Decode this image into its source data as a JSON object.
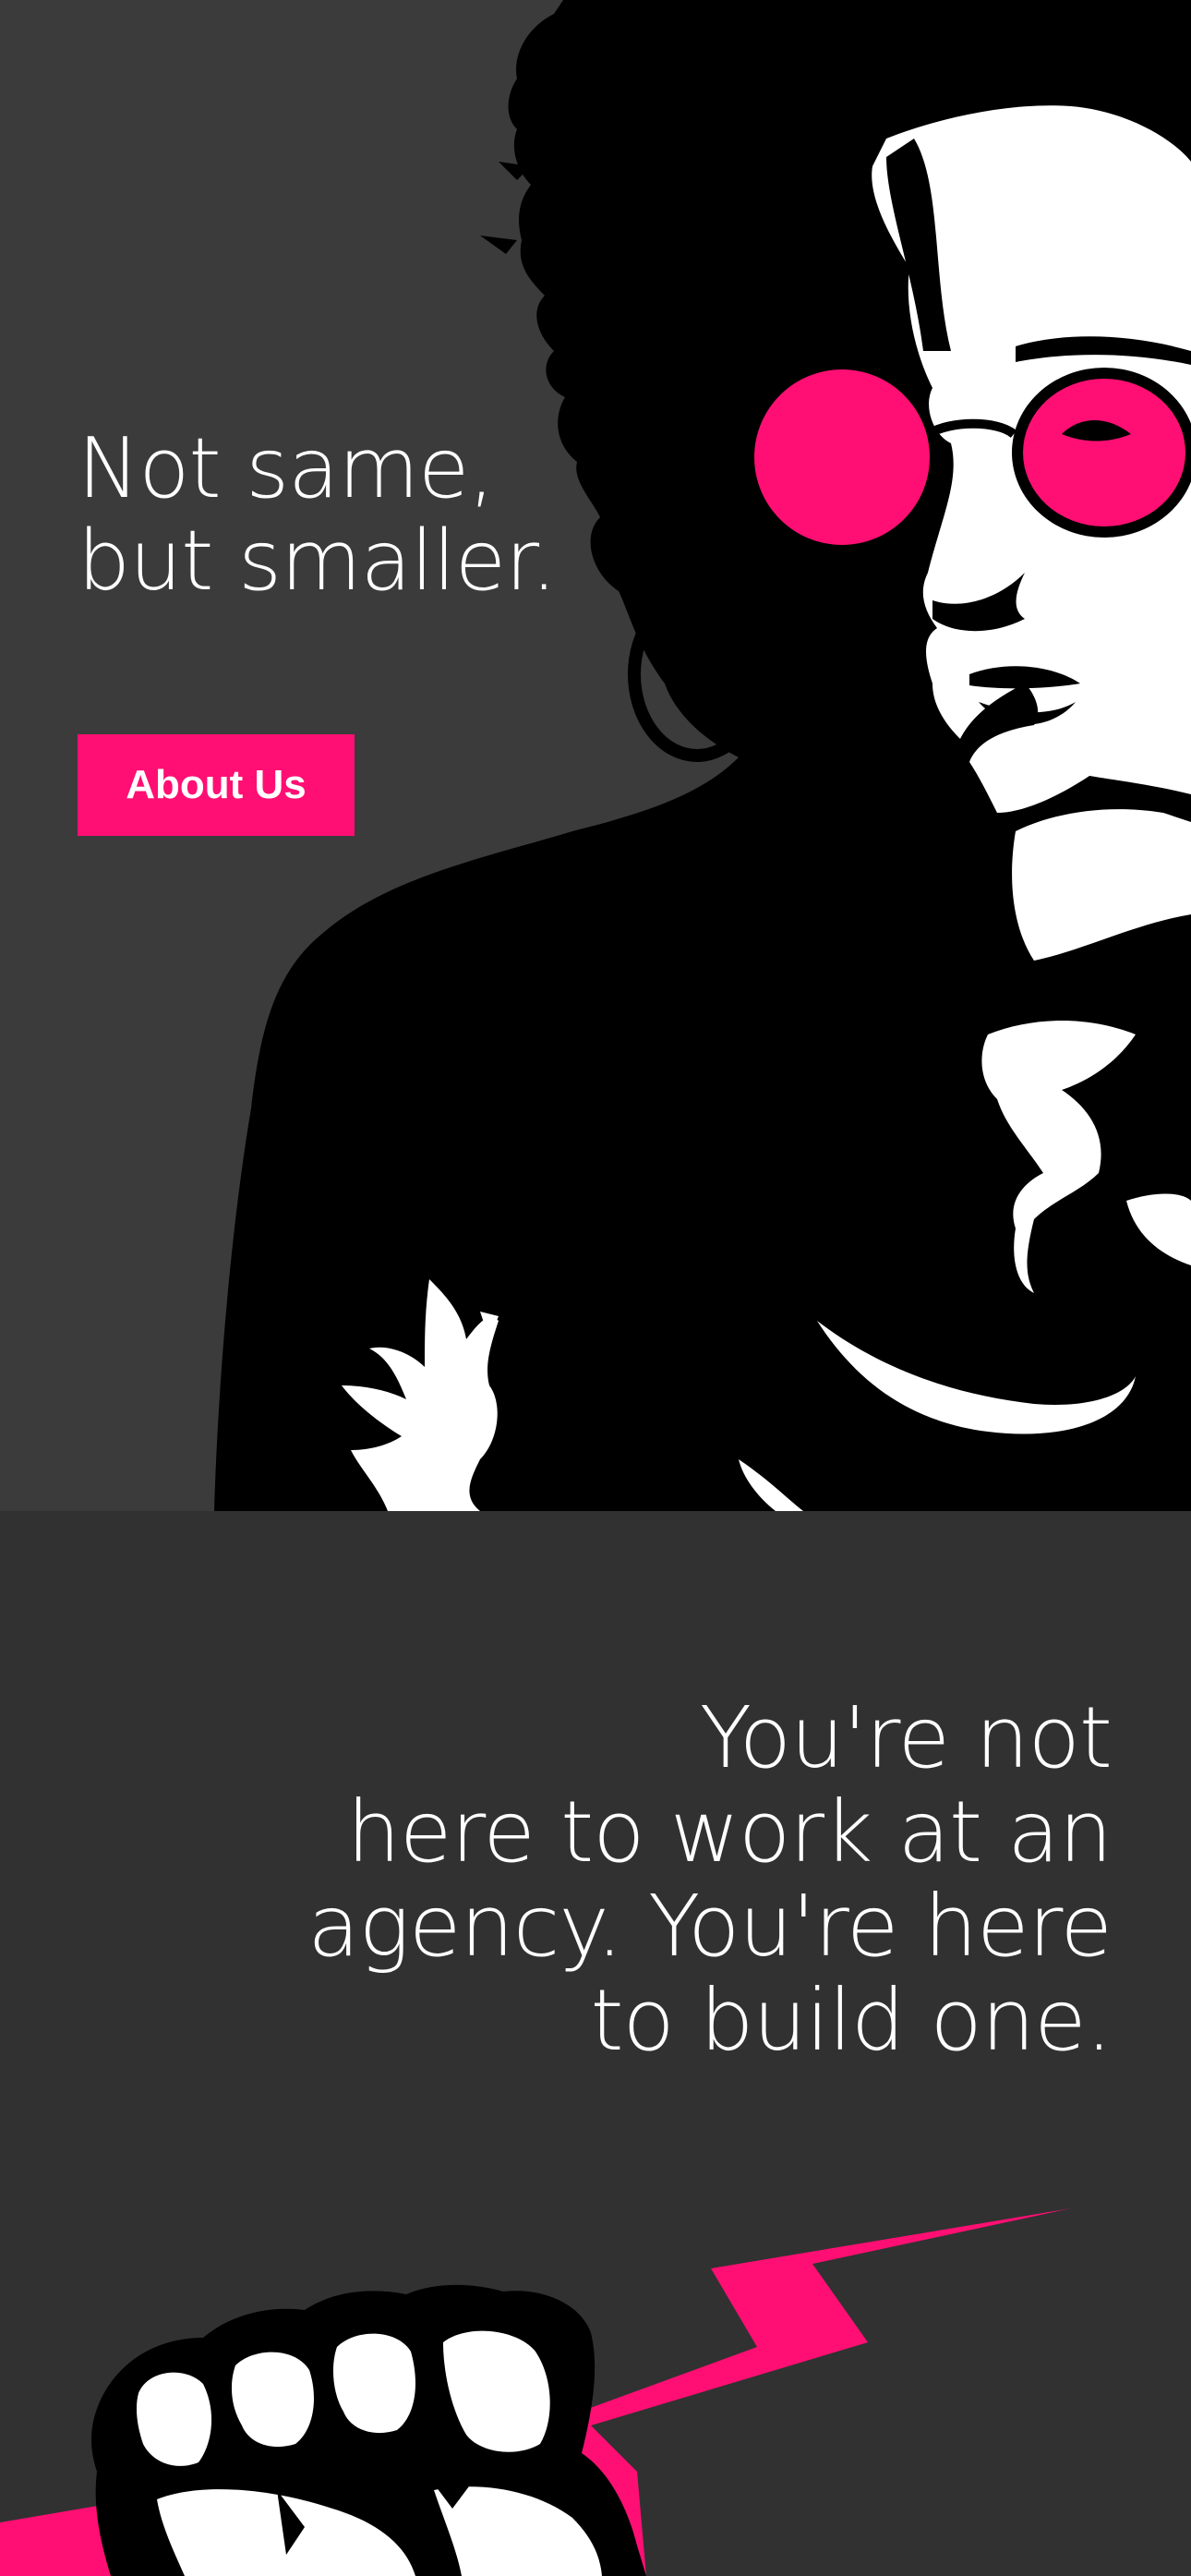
{
  "hero": {
    "title_line1": "Not same,",
    "title_line2": "but smaller.",
    "button_label": "About Us"
  },
  "section_two": {
    "tagline_line1": "You're not",
    "tagline_line2": "here to work at an",
    "tagline_line3": "agency. You're here",
    "tagline_line4": "to build one."
  },
  "colors": {
    "accent": "#ff0f73",
    "hero_background": "#3b3b3b",
    "section_background": "#313131",
    "text": "#ffffff"
  },
  "icons": {
    "hero_illustration": "woman-with-pink-sunglasses-illustration",
    "fist_illustration": "fist-holding-lightning-bolt-illustration"
  }
}
